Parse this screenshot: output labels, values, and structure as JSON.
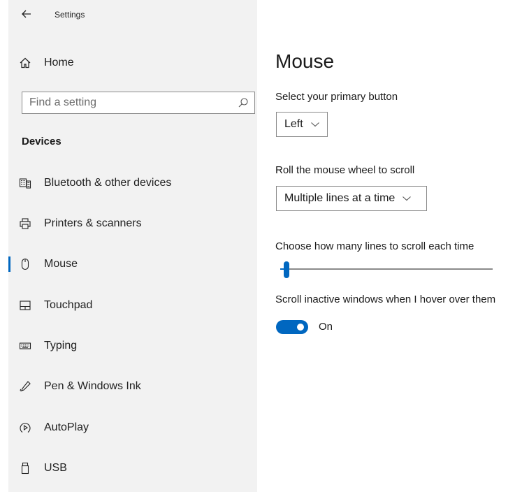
{
  "app": {
    "title": "Settings"
  },
  "sidebar": {
    "home_label": "Home",
    "search_placeholder": "Find a setting",
    "section_title": "Devices",
    "items": [
      {
        "label": "Bluetooth & other devices",
        "icon": "bluetooth-devices-icon"
      },
      {
        "label": "Printers & scanners",
        "icon": "printer-icon"
      },
      {
        "label": "Mouse",
        "icon": "mouse-icon",
        "selected": true
      },
      {
        "label": "Touchpad",
        "icon": "touchpad-icon"
      },
      {
        "label": "Typing",
        "icon": "keyboard-icon"
      },
      {
        "label": "Pen & Windows Ink",
        "icon": "pen-icon"
      },
      {
        "label": "AutoPlay",
        "icon": "autoplay-icon"
      },
      {
        "label": "USB",
        "icon": "usb-icon"
      }
    ]
  },
  "main": {
    "title": "Mouse",
    "primary_button": {
      "label": "Select your primary button",
      "value": "Left"
    },
    "scroll_wheel": {
      "label": "Roll the mouse wheel to scroll",
      "value": "Multiple lines at a time"
    },
    "lines_slider": {
      "label": "Choose how many lines to scroll each time",
      "level": 0.03
    },
    "inactive_scroll": {
      "label": "Scroll inactive windows when I hover over them",
      "state": "On"
    }
  },
  "colors": {
    "accent": "#0067c0",
    "sidebar_bg": "#f2f2f2",
    "page_bg": "#ffffff"
  }
}
